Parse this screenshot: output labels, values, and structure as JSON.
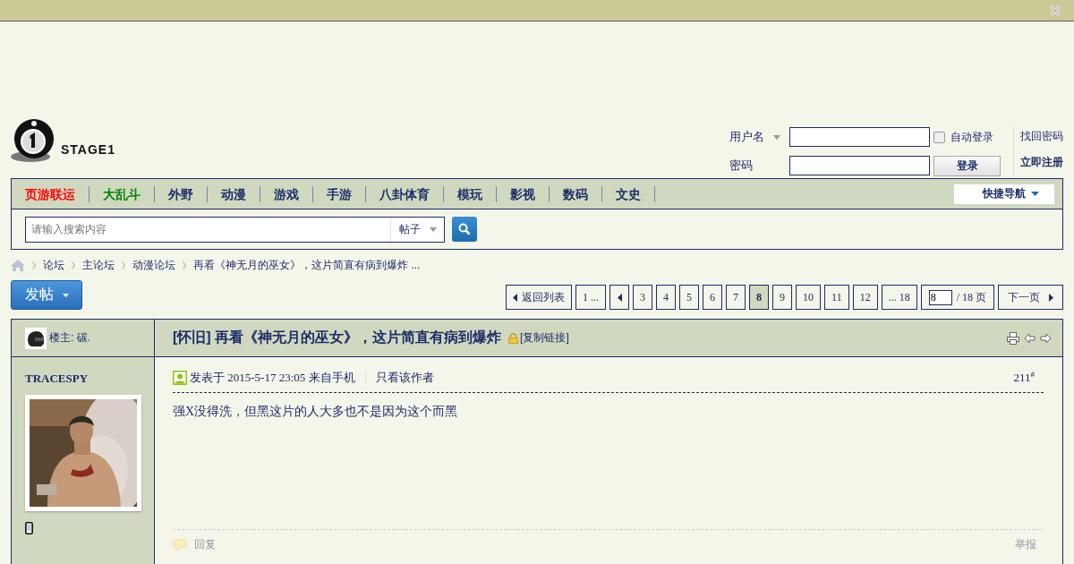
{
  "logo": {
    "text": "STAGE1"
  },
  "login": {
    "username_label": "用户名",
    "password_label": "密码",
    "auto_login": {
      "label": "自动登录",
      "checked": false
    },
    "login_button": "登录",
    "links": [
      {
        "label": "找回密码",
        "bold": false
      },
      {
        "label": "立即注册",
        "bold": true
      }
    ]
  },
  "nav": {
    "items": [
      {
        "label": "页游联运",
        "color": "#ff0000"
      },
      {
        "label": "大乱斗",
        "color": "#008000"
      },
      {
        "label": "外野",
        "color": "#1c2c6a"
      },
      {
        "label": "动漫",
        "color": "#1c2c6a"
      },
      {
        "label": "游戏",
        "color": "#1c2c6a"
      },
      {
        "label": "手游",
        "color": "#1c2c6a"
      },
      {
        "label": "八卦体育",
        "color": "#1c2c6a"
      },
      {
        "label": "模玩",
        "color": "#1c2c6a"
      },
      {
        "label": "影视",
        "color": "#1c2c6a"
      },
      {
        "label": "数码",
        "color": "#1c2c6a"
      },
      {
        "label": "文史",
        "color": "#1c2c6a"
      }
    ],
    "quick_nav": "快捷导航"
  },
  "search": {
    "placeholder": "请输入搜索内容",
    "scope": "帖子"
  },
  "breadcrumb": [
    "论坛",
    "主论坛",
    "动漫论坛",
    "再看《神无月的巫女》，这片简直有病到爆炸 ..."
  ],
  "post_button": "发帖",
  "pagination": {
    "back": "返回列表",
    "pages": [
      {
        "kind": "page",
        "label": "1 ...",
        "selected": false
      },
      {
        "kind": "prev",
        "selected": false
      },
      {
        "kind": "page",
        "label": "3",
        "selected": false
      },
      {
        "kind": "page",
        "label": "4",
        "selected": false
      },
      {
        "kind": "page",
        "label": "5",
        "selected": false
      },
      {
        "kind": "page",
        "label": "6",
        "selected": false
      },
      {
        "kind": "page",
        "label": "7",
        "selected": false
      },
      {
        "kind": "page",
        "label": "8",
        "selected": true
      },
      {
        "kind": "page",
        "label": "9",
        "selected": false
      },
      {
        "kind": "page",
        "label": "10",
        "selected": false
      },
      {
        "kind": "page",
        "label": "11",
        "selected": false
      },
      {
        "kind": "page",
        "label": "12",
        "selected": false
      },
      {
        "kind": "page",
        "label": "... 18",
        "selected": false
      }
    ],
    "page_input": "8",
    "total": "/ 18 页",
    "next": "下一页"
  },
  "thread": {
    "author_label": "楼主: 碳.",
    "title": "[怀旧] 再看《神无月的巫女》，这片简直有病到爆炸",
    "copy_link": "[复制链接]"
  },
  "post": {
    "username": "TRACESPY",
    "posted": "发表于 2015-5-17 23:05 来自手机",
    "only_author": "只看该作者",
    "floor": "211$^{#}$",
    "content": "强X没得洗，但黑这片的人大多也不是因为这个而黑",
    "reply": "回复",
    "report": "举报"
  }
}
